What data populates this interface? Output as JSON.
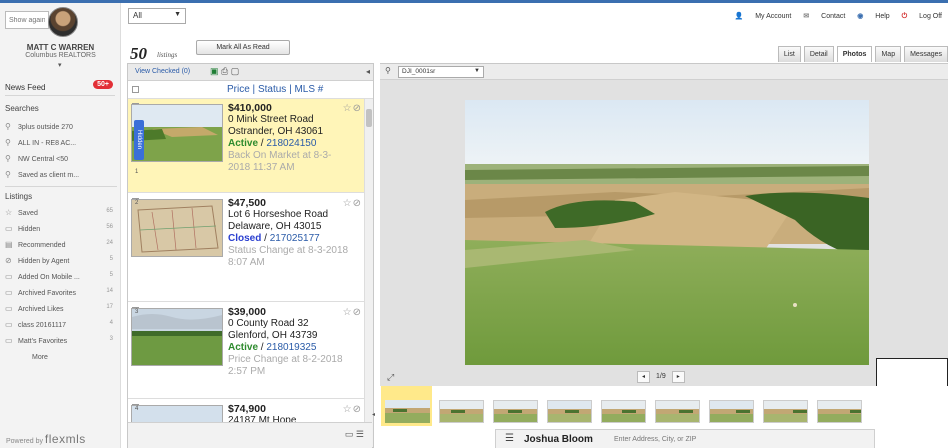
{
  "sidebar": {
    "show_placeholder": "Show again",
    "user_name": "MATT C WARREN",
    "user_org": "Columbus REALTORS",
    "caret": "▾",
    "news_feed": {
      "label": "News Feed",
      "badge": "50+"
    },
    "searches_title": "Searches",
    "searches": [
      {
        "label": "3plus outside 270",
        "icon": "saved-search-icon"
      },
      {
        "label": "ALL IN - RE8 AC...",
        "icon": "saved-search-icon"
      },
      {
        "label": "NW Central <50",
        "icon": "saved-search-icon"
      },
      {
        "label": "Saved as client m...",
        "icon": "search-icon"
      }
    ],
    "listings_title": "Listings",
    "listings": [
      {
        "label": "Saved",
        "count": "65"
      },
      {
        "label": "Hidden",
        "count": "56"
      },
      {
        "label": "Recommended",
        "count": "24"
      },
      {
        "label": "Hidden by Agent",
        "count": "5"
      },
      {
        "label": "Added On Mobile ...",
        "count": "5"
      },
      {
        "label": "Archived Favorites",
        "count": "14"
      },
      {
        "label": "Archived Likes",
        "count": "17"
      },
      {
        "label": "class 20161117",
        "count": "4"
      },
      {
        "label": "Matt's Favorites",
        "count": "3"
      }
    ],
    "more": "More",
    "powered_by": "Powered by",
    "brand": "flexmls"
  },
  "topbar": {
    "filter_value": "All",
    "links": {
      "account": "My Account",
      "contact": "Contact",
      "help": "Help",
      "logoff": "Log Off"
    }
  },
  "results": {
    "count": "50",
    "count_word": "listings",
    "mark_read": "Mark All As Read"
  },
  "view_tabs": [
    "List",
    "Detail",
    "Photos",
    "Map",
    "Messages"
  ],
  "active_tab": "Photos",
  "list": {
    "view_checked": "View Checked (0)",
    "sort_label": "Price | Status | MLS #",
    "expand_tab": "Hidden",
    "items": [
      {
        "num": "1",
        "price": "$410,000",
        "street": "0 Mink Street Road",
        "city": "Ostrander, OH 43061",
        "status": "Active",
        "mls": "218024150",
        "change": "Back On Market at 8-3-2018 11:37 AM",
        "selected": true
      },
      {
        "num": "2",
        "price": "$47,500",
        "street": "Lot 6 Horseshoe Road",
        "city": "Delaware, OH 43015",
        "status": "Closed",
        "mls": "217025177",
        "change": "Status Change at 8-3-2018 8:07 AM",
        "selected": false
      },
      {
        "num": "3",
        "price": "$39,000",
        "street": "0 County Road 32",
        "city": "Glenford, OH 43739",
        "status": "Active",
        "mls": "218019325",
        "change": "Price Change at 8-2-2018 2:57 PM",
        "selected": false
      },
      {
        "num": "4",
        "price": "$74,900",
        "street": "24187 Mt Hope",
        "city": "",
        "status": "",
        "mls": "",
        "change": "",
        "selected": false
      }
    ]
  },
  "photo_viewer": {
    "photo_name": "DJI_0001sr",
    "current": "1",
    "total": "9",
    "page_text": "1/9",
    "thumbnail_count": 9
  },
  "contact_bar": {
    "name": "Joshua Bloom",
    "address_placeholder": "Enter Address, City, or ZIP"
  },
  "colors": {
    "accent_blue": "#2a5ba8",
    "active_green": "#2e8b2e",
    "closed_blue": "#2a3fd0",
    "selected_row": "#fff5b8",
    "badge_red": "#e22f36"
  }
}
